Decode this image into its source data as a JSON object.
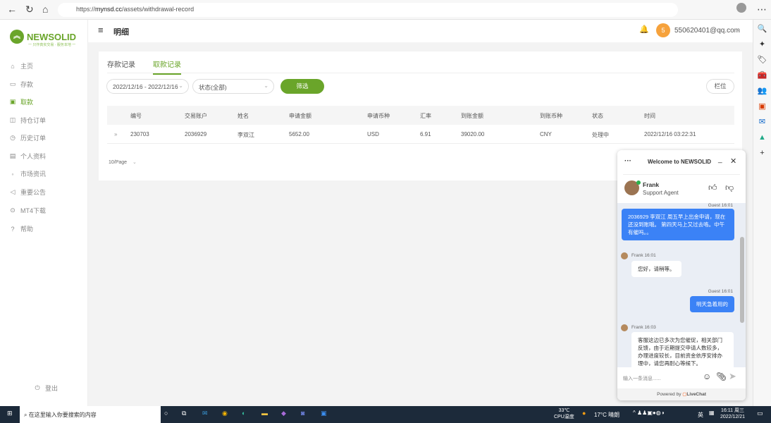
{
  "browser": {
    "url_prefix": "https://",
    "url_host": "mynsd.cc",
    "url_path": "/assets/withdrawal-record"
  },
  "brand": {
    "name": "NEWSOLID",
    "slogan": "一 只作真实交易 · 服务本地 一",
    "color": "#6aa52a"
  },
  "sidebar": {
    "items": [
      {
        "label": "主页",
        "icon": "home-icon"
      },
      {
        "label": "存款",
        "icon": "card-icon"
      },
      {
        "label": "取款",
        "icon": "wallet-icon",
        "active": true
      },
      {
        "label": "持仓订单",
        "icon": "chart-icon"
      },
      {
        "label": "历史订单",
        "icon": "clock-icon"
      },
      {
        "label": "个人资料",
        "icon": "profile-icon"
      },
      {
        "label": "市场资讯",
        "icon": "broadcast-icon"
      },
      {
        "label": "重要公告",
        "icon": "speaker-icon"
      },
      {
        "label": "MT4下载",
        "icon": "download-icon"
      },
      {
        "label": "帮助",
        "icon": "help-icon"
      }
    ],
    "logout": "登出"
  },
  "header": {
    "title": "明细",
    "avatar_letter": "5",
    "email": "550620401@qq.com"
  },
  "tabs": [
    {
      "label": "存款记录"
    },
    {
      "label": "取款记录",
      "active": true
    }
  ],
  "filters": {
    "date_range": "2022/12/16 - 2022/12/16",
    "status": "状态(全部)",
    "filter_label": "筛选",
    "columns_label": "栏位"
  },
  "table": {
    "headers": [
      "编号",
      "交易账户",
      "姓名",
      "申请金额",
      "申请币种",
      "汇率",
      "到账金额",
      "到账币种",
      "状态",
      "时间"
    ],
    "rows": [
      [
        "230703",
        "2036929",
        "李双江",
        "5652.00",
        "USD",
        "6.91",
        "39020.00",
        "CNY",
        "处理中",
        "2022/12/16 03:22:31"
      ]
    ]
  },
  "pager": {
    "page_size": "10/Page"
  },
  "chat": {
    "title": "Welcome to NEWSOLID",
    "agent_name": "Frank",
    "agent_role": "Support Agent",
    "messages": [
      {
        "meta": "Guest 16:01",
        "text": "2036929 李双江 周五早上出金申请，现在还没到账哦。 第四天马上又过去咯。中午有催吗。。"
      },
      {
        "meta": "Frank 16:01",
        "text": "您好，请稍等。"
      },
      {
        "meta": "Guest 16:01",
        "text": "明天急着用的"
      },
      {
        "meta": "Frank 16:03",
        "text": "客服这边已多次为您催促，相关部门反馈，由于近期提交申请人数较多，办理进度较长，目前资金依序安排办理中，请您再耐心等候下。"
      }
    ],
    "input_placeholder": "输入一条消息......",
    "powered_by": "Powered by",
    "powered_brand": "LiveChat"
  },
  "taskbar": {
    "search_placeholder": "在这里输入你要搜索的内容",
    "cpu_temp": "33℃",
    "cpu_label": "CPU温度",
    "weather": "17°C 晴朗",
    "lang": "英",
    "time": "16:11 周三",
    "date": "2022/12/21"
  }
}
